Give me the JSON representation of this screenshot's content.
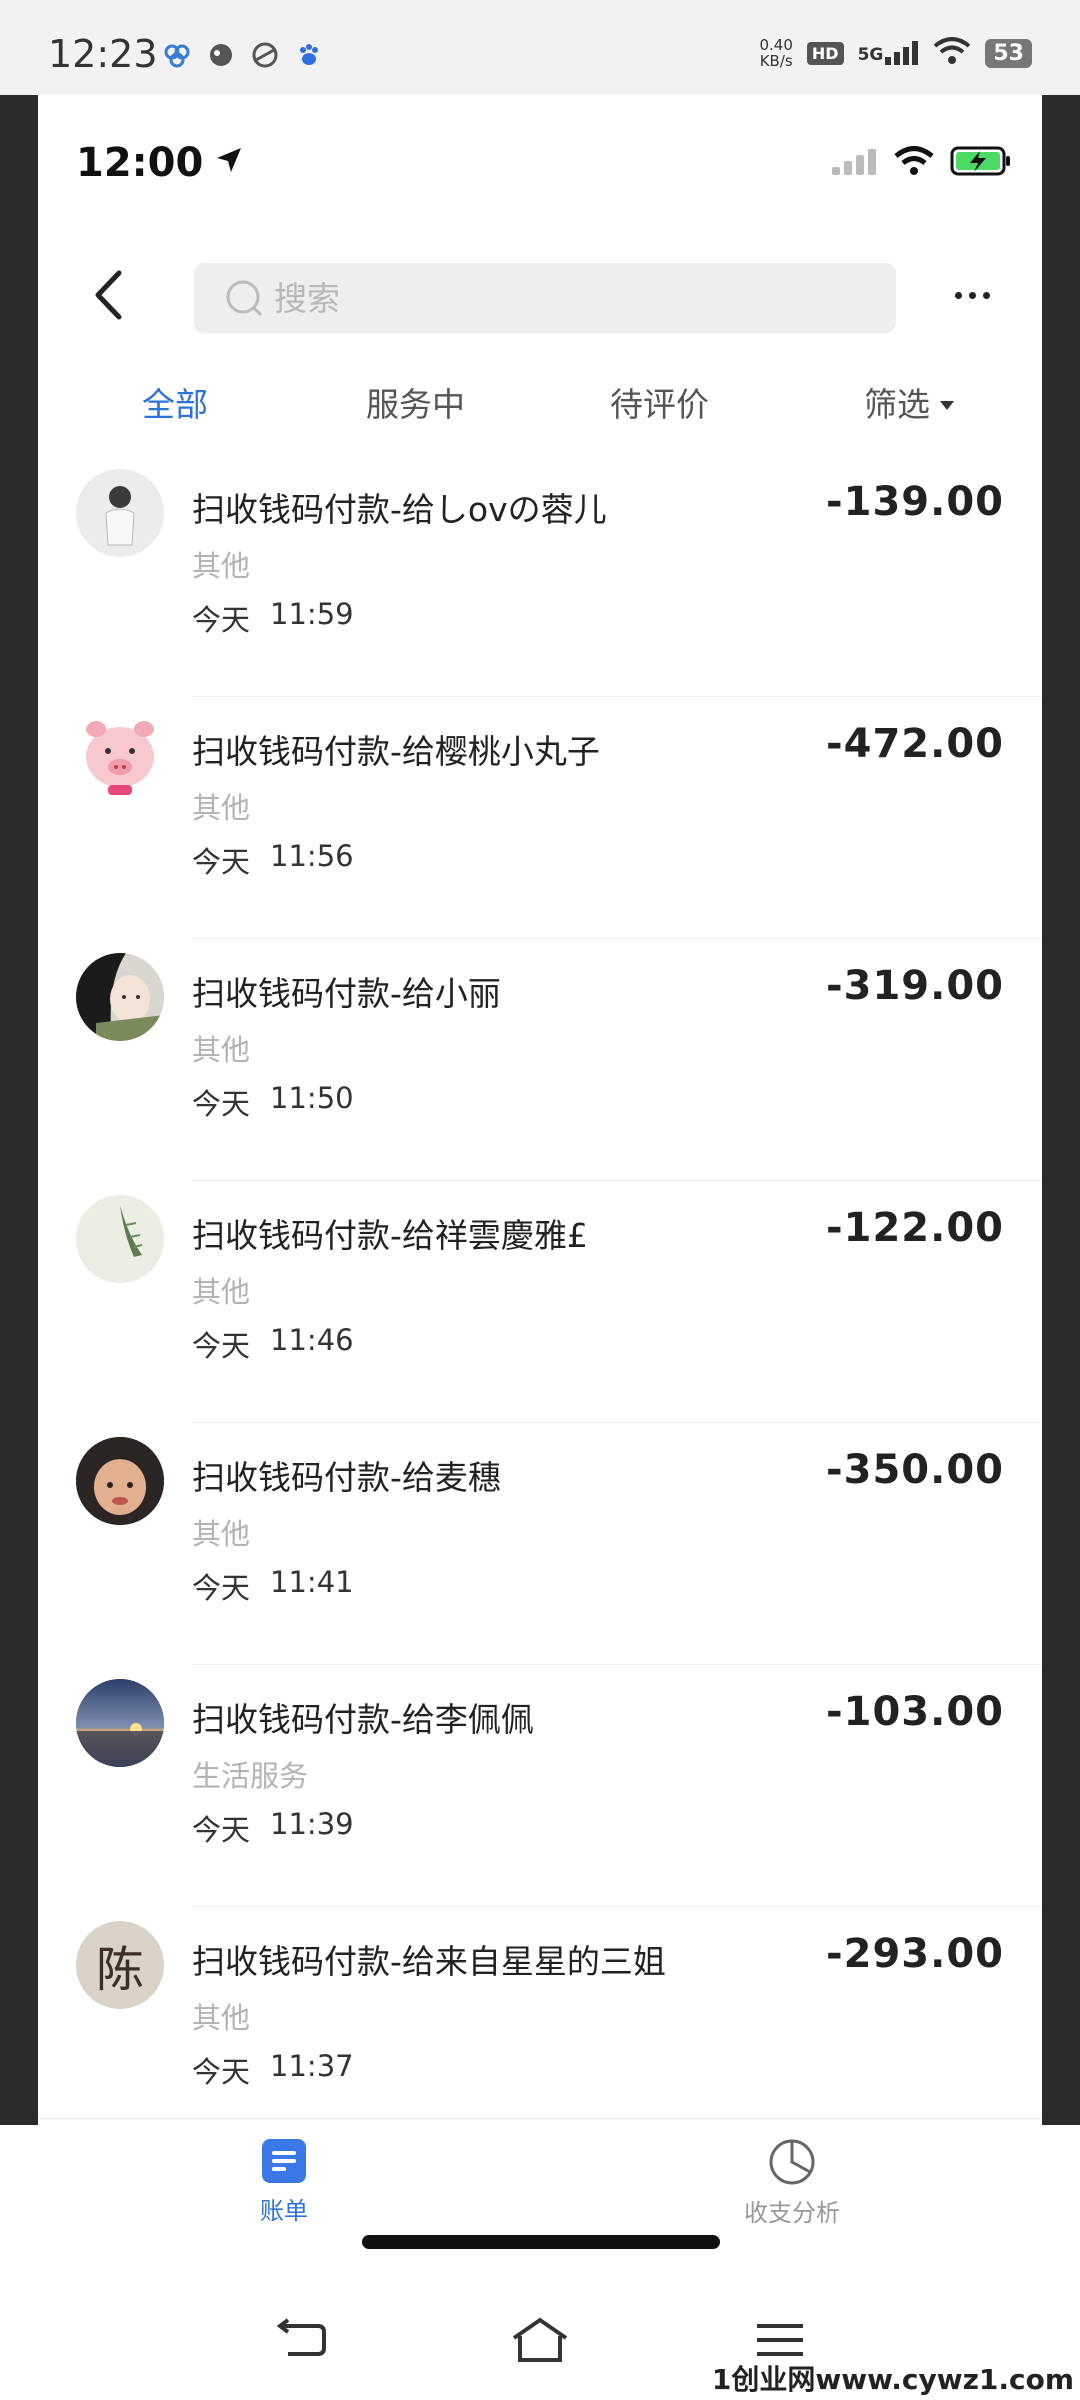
{
  "android_status": {
    "time": "12:23",
    "speed_value": "0.40",
    "speed_unit": "KB/s",
    "hd": "HD",
    "network": "5G",
    "battery": "53"
  },
  "ios_status": {
    "time": "12:00"
  },
  "search": {
    "placeholder": "搜索"
  },
  "tabs": [
    {
      "label": "全部",
      "active": true
    },
    {
      "label": "服务中",
      "active": false
    },
    {
      "label": "待评价",
      "active": false
    },
    {
      "label": "筛选",
      "active": false
    }
  ],
  "transactions": [
    {
      "title": "扫收钱码付款-给しovの蓉儿",
      "category": "其他",
      "day": "今天",
      "time": "11:59",
      "amount": "-139.00",
      "avatar": "child-photo-avatar"
    },
    {
      "title": "扫收钱码付款-给樱桃小丸子",
      "category": "其他",
      "day": "今天",
      "time": "11:56",
      "amount": "-472.00",
      "avatar": "cartoon-pig-avatar"
    },
    {
      "title": "扫收钱码付款-给小丽",
      "category": "其他",
      "day": "今天",
      "time": "11:50",
      "amount": "-319.00",
      "avatar": "girl-photo-avatar"
    },
    {
      "title": "扫收钱码付款-给祥雲慶雅£",
      "category": "其他",
      "day": "今天",
      "time": "11:46",
      "amount": "-122.00",
      "avatar": "plant-photo-avatar"
    },
    {
      "title": "扫收钱码付款-给麦穗",
      "category": "其他",
      "day": "今天",
      "time": "11:41",
      "amount": "-350.00",
      "avatar": "baby-photo-avatar"
    },
    {
      "title": "扫收钱码付款-给李佩佩",
      "category": "生活服务",
      "day": "今天",
      "time": "11:39",
      "amount": "-103.00",
      "avatar": "sunset-photo-avatar"
    },
    {
      "title": "扫收钱码付款-给来自星星的三姐",
      "category": "其他",
      "day": "今天",
      "time": "11:37",
      "amount": "-293.00",
      "avatar": "text-avatar",
      "avatar_text": "陈"
    }
  ],
  "tabbar": {
    "bill_label": "账单",
    "analysis_label": "收支分析"
  },
  "watermark": "1创业网www.cywz1.com",
  "colors": {
    "accent": "#2b73d9",
    "text": "#222222",
    "muted": "#b3b3b3"
  }
}
